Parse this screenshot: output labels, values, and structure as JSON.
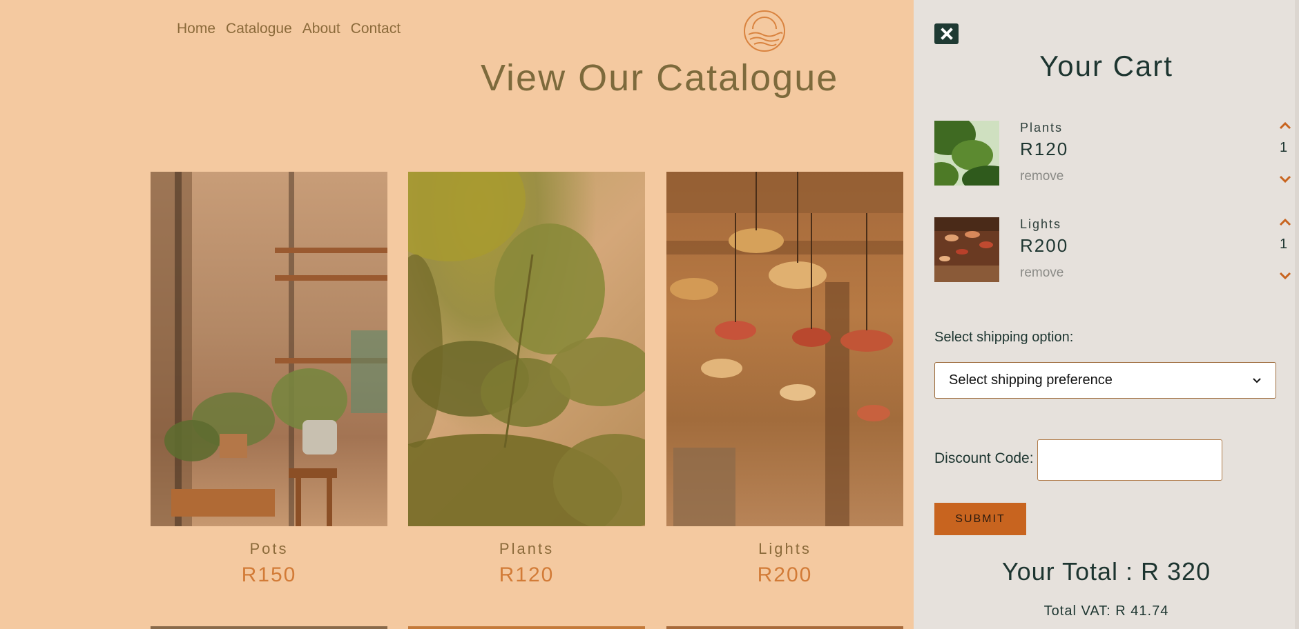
{
  "nav": {
    "items": [
      {
        "label": "Home"
      },
      {
        "label": "Catalogue"
      },
      {
        "label": "About"
      },
      {
        "label": "Contact"
      }
    ]
  },
  "logo": {
    "icon": "sun-over-waves-icon",
    "color": "#d9833f"
  },
  "page": {
    "title": "View Our Catalogue"
  },
  "catalogue": [
    {
      "name": "Pots",
      "price": "R150"
    },
    {
      "name": "Plants",
      "price": "R120"
    },
    {
      "name": "Lights",
      "price": "R200"
    }
  ],
  "cart": {
    "title": "Your Cart",
    "close_icon": "close-icon",
    "items": [
      {
        "name": "Plants",
        "price": "R120",
        "remove_label": "remove",
        "quantity": "1"
      },
      {
        "name": "Lights",
        "price": "R200",
        "remove_label": "remove",
        "quantity": "1"
      }
    ],
    "shipping_label": "Select shipping option:",
    "shipping_selected": "Select shipping preference",
    "discount_label": "Discount Code:",
    "discount_value": "",
    "submit_label": "SUBMIT",
    "total": "Your Total : R 320",
    "vat": "Total VAT: R 41.74"
  },
  "colors": {
    "page_bg": "#f4c9a0",
    "cart_bg": "#e6e1dc",
    "accent": "#c8641f",
    "dark": "#1d3530",
    "price": "#d27b37"
  }
}
